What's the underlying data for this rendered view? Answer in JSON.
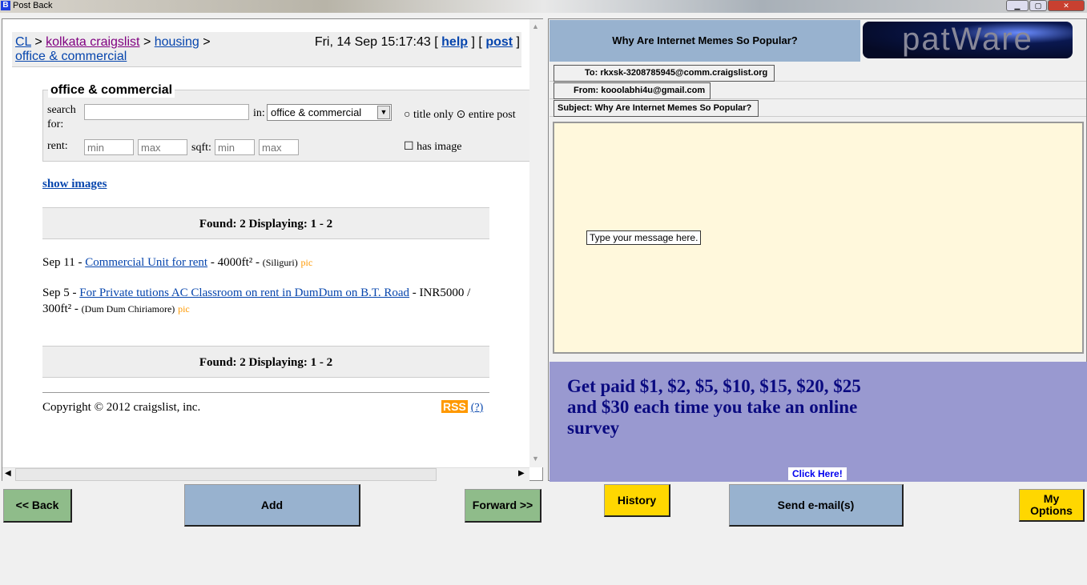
{
  "window": {
    "title": "Post Back"
  },
  "browser": {
    "breadcrumb": {
      "cl": "CL",
      "sep": ">",
      "city": "kolkata craigslist",
      "section": "housing",
      "category": "office & commercial"
    },
    "datetime": "Fri, 14 Sep 15:17:43",
    "help": "help",
    "post": "post",
    "lb": "[",
    "rb": "]",
    "search": {
      "legend": "office & commercial",
      "search_label": "search for:",
      "in_label": "in:",
      "category_value": "office & commercial",
      "title_only": "title only",
      "entire_post": "entire post",
      "rent_label": "rent:",
      "sqft_label": "sqft:",
      "min_placeholder": "min",
      "max_placeholder": "max",
      "has_image": "has image"
    },
    "show_images": "show images",
    "found": "Found: 2 Displaying: 1 - 2",
    "listings": [
      {
        "date": "Sep 11",
        "title": "Commercial Unit for rent",
        "details": "- 4000ft² -",
        "location": "(Siliguri)",
        "pic": "pic"
      },
      {
        "date": "Sep 5",
        "title": "For Private tutions AC Classroom on rent in DumDum on B.T. Road",
        "details": "- INR5000 / 300ft² -",
        "location": "(Dum Dum Chiriamore)",
        "pic": "pic"
      }
    ],
    "copyright": "Copyright © 2012 craigslist, inc.",
    "rss": "RSS",
    "rss_help": "(?)"
  },
  "email": {
    "header_title": "Why Are Internet Memes So Popular?",
    "logo": "patWare",
    "to": "To: rkxsk-3208785945@comm.craigslist.org",
    "from": "From: kooolabhi4u@gmail.com",
    "subject": "Subject: Why Are Internet Memes So Popular?",
    "message_placeholder": "Type your message here.",
    "ad_text": "Get paid $1, $2, $5, $10, $15, $20, $25 and $30 each time you take an online survey",
    "ad_click": "Click Here!"
  },
  "buttons": {
    "back": "<< Back",
    "add": "Add",
    "forward": "Forward >>",
    "history": "History",
    "send": "Send e-mail(s)",
    "options": "My Options"
  }
}
